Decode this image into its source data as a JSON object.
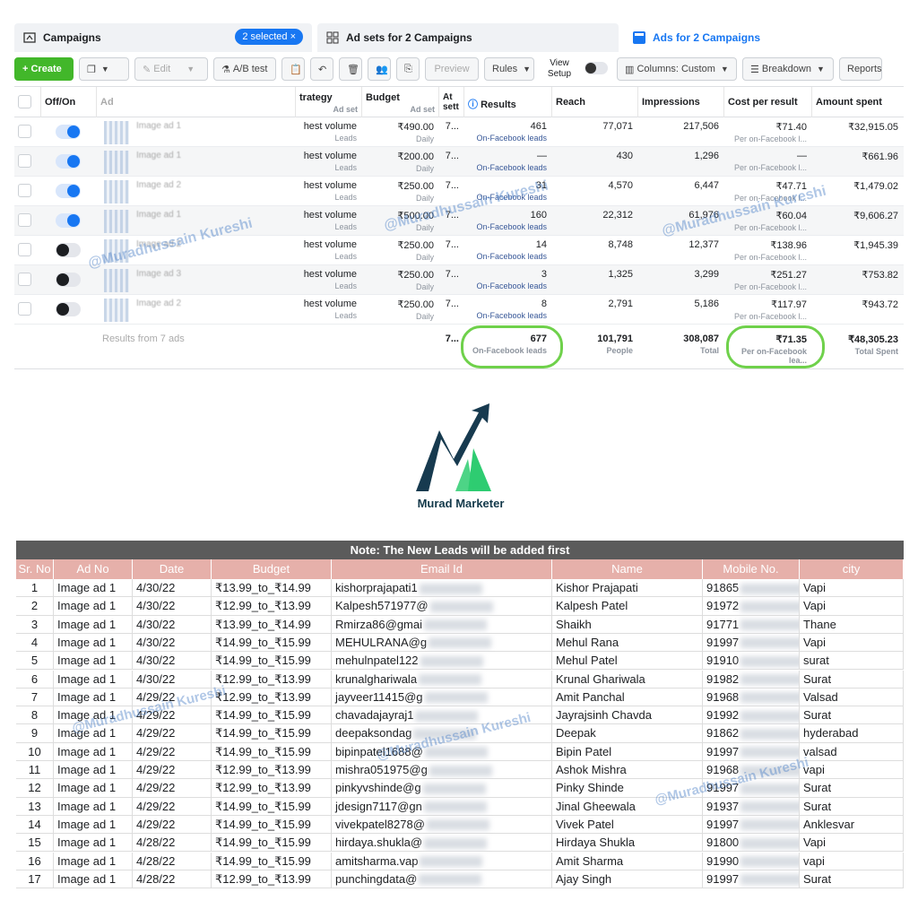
{
  "tabs": {
    "campaigns": "Campaigns",
    "selected": "2 selected",
    "adsets": "Ad sets for 2 Campaigns",
    "ads": "Ads for 2 Campaigns"
  },
  "toolbar": {
    "create": "+ Create",
    "edit": "Edit",
    "abtest": "A/B test",
    "preview": "Preview",
    "rules": "Rules",
    "view_setup": "View Setup",
    "columns": "Columns: Custom",
    "breakdown": "Breakdown",
    "reports": "Reports"
  },
  "columns": {
    "offon": "Off/On",
    "ad": "Ad",
    "strategy": "trategy",
    "budget": "Budget",
    "budget_sub": "Ad set",
    "strategy_sub": "Ad set",
    "attr": "At sett",
    "results": "Results",
    "reach": "Reach",
    "impressions": "Impressions",
    "cpr": "Cost per result",
    "spent": "Amount spent"
  },
  "ads": [
    {
      "name": "Image ad 1",
      "on": true,
      "strategy": "hest volume",
      "strategy_sub": "Leads",
      "budget": "₹490.00",
      "budget_sub": "Daily",
      "attr": "7...",
      "results": "461",
      "results_sub": "On-Facebook leads",
      "reach": "77,071",
      "impressions": "217,506",
      "cpr": "₹71.40",
      "cpr_sub": "Per on-Facebook l...",
      "spent": "₹32,915.05"
    },
    {
      "name": "Image ad 1",
      "on": true,
      "strategy": "hest volume",
      "strategy_sub": "Leads",
      "budget": "₹200.00",
      "budget_sub": "Daily",
      "attr": "7...",
      "results": "—",
      "results_sub": "On-Facebook leads",
      "reach": "430",
      "impressions": "1,296",
      "cpr": "—",
      "cpr_sub": "Per on-Facebook l...",
      "spent": "₹661.96"
    },
    {
      "name": "Image ad 2",
      "on": true,
      "strategy": "hest volume",
      "strategy_sub": "Leads",
      "budget": "₹250.00",
      "budget_sub": "Daily",
      "attr": "7...",
      "results": "31",
      "results_sub": "On-Facebook leads",
      "reach": "4,570",
      "impressions": "6,447",
      "cpr": "₹47.71",
      "cpr_sub": "Per on-Facebook l...",
      "spent": "₹1,479.02"
    },
    {
      "name": "Image ad 1",
      "on": true,
      "strategy": "hest volume",
      "strategy_sub": "Leads",
      "budget": "₹500.00",
      "budget_sub": "Daily",
      "attr": "7...",
      "results": "160",
      "results_sub": "On-Facebook leads",
      "reach": "22,312",
      "impressions": "61,976",
      "cpr": "₹60.04",
      "cpr_sub": "Per on-Facebook l...",
      "spent": "₹9,606.27"
    },
    {
      "name": "Image ad 2",
      "on": false,
      "strategy": "hest volume",
      "strategy_sub": "Leads",
      "budget": "₹250.00",
      "budget_sub": "Daily",
      "attr": "7...",
      "results": "14",
      "results_sub": "On-Facebook leads",
      "reach": "8,748",
      "impressions": "12,377",
      "cpr": "₹138.96",
      "cpr_sub": "Per on-Facebook l...",
      "spent": "₹1,945.39"
    },
    {
      "name": "Image ad 3",
      "on": false,
      "strategy": "hest volume",
      "strategy_sub": "Leads",
      "budget": "₹250.00",
      "budget_sub": "Daily",
      "attr": "7...",
      "results": "3",
      "results_sub": "On-Facebook leads",
      "reach": "1,325",
      "impressions": "3,299",
      "cpr": "₹251.27",
      "cpr_sub": "Per on-Facebook l...",
      "spent": "₹753.82"
    },
    {
      "name": "Image ad 2",
      "on": false,
      "strategy": "hest volume",
      "strategy_sub": "Leads",
      "budget": "₹250.00",
      "budget_sub": "Daily",
      "attr": "7...",
      "results": "8",
      "results_sub": "On-Facebook leads",
      "reach": "2,791",
      "impressions": "5,186",
      "cpr": "₹117.97",
      "cpr_sub": "Per on-Facebook l...",
      "spent": "₹943.72"
    }
  ],
  "totals": {
    "label": "Results from 7 ads",
    "attr": "7...",
    "results": "677",
    "results_sub": "On-Facebook leads",
    "reach": "101,791",
    "reach_sub": "People",
    "impressions": "308,087",
    "impressions_sub": "Total",
    "cpr": "₹71.35",
    "cpr_sub": "Per on-Facebook lea...",
    "spent": "₹48,305.23",
    "spent_sub": "Total Spent"
  },
  "watermark": "@Muradhussain Kureshi",
  "logo": {
    "name": "Murad Marketer",
    "colors": {
      "dark": "#173a4f",
      "green": "#2ecc71"
    }
  },
  "sheet": {
    "note": "Note: The New Leads will be added first",
    "headers": [
      "Sr. No",
      "Ad No",
      "Date",
      "Budget",
      "Email Id",
      "Name",
      "Mobile No.",
      "city"
    ],
    "rows": [
      [
        "1",
        "Image ad 1",
        "4/30/22",
        "₹13.99_to_₹14.99",
        "kishorprajapati1",
        "Kishor Prajapati",
        "91865",
        "Vapi"
      ],
      [
        "2",
        "Image ad 1",
        "4/30/22",
        "₹12.99_to_₹13.99",
        "Kalpesh571977@",
        "Kalpesh Patel",
        "91972",
        "Vapi"
      ],
      [
        "3",
        "Image ad 1",
        "4/30/22",
        "₹13.99_to_₹14.99",
        "Rmirza86@gmai",
        "Shaikh",
        "91771",
        "Thane"
      ],
      [
        "4",
        "Image ad 1",
        "4/30/22",
        "₹14.99_to_₹15.99",
        "MEHULRANA@g",
        "Mehul Rana",
        "91997",
        "Vapi"
      ],
      [
        "5",
        "Image ad 1",
        "4/30/22",
        "₹14.99_to_₹15.99",
        "mehulnpatel122",
        "Mehul Patel",
        "91910",
        "surat"
      ],
      [
        "6",
        "Image ad 1",
        "4/30/22",
        "₹12.99_to_₹13.99",
        "krunalghariwala",
        "Krunal Ghariwala",
        "91982",
        "Surat"
      ],
      [
        "7",
        "Image ad 1",
        "4/29/22",
        "₹12.99_to_₹13.99",
        "jayveer11415@g",
        "Amit Panchal",
        "91968",
        "Valsad"
      ],
      [
        "8",
        "Image ad 1",
        "4/29/22",
        "₹14.99_to_₹15.99",
        "chavadajayraj1",
        "Jayrajsinh Chavda",
        "91992",
        "Surat"
      ],
      [
        "9",
        "Image ad 1",
        "4/29/22",
        "₹14.99_to_₹15.99",
        "deepaksondag",
        "Deepak",
        "91862",
        "hyderabad"
      ],
      [
        "10",
        "Image ad 1",
        "4/29/22",
        "₹14.99_to_₹15.99",
        "bipinpatel1688@",
        "Bipin Patel",
        "91997",
        "valsad"
      ],
      [
        "11",
        "Image ad 1",
        "4/29/22",
        "₹12.99_to_₹13.99",
        "mishra051975@g",
        "Ashok Mishra",
        "91968",
        "vapi"
      ],
      [
        "12",
        "Image ad 1",
        "4/29/22",
        "₹12.99_to_₹13.99",
        "pinkyvshinde@g",
        "Pinky Shinde",
        "91997",
        "Surat"
      ],
      [
        "13",
        "Image ad 1",
        "4/29/22",
        "₹14.99_to_₹15.99",
        "jdesign7117@gn",
        "Jinal Gheewala",
        "91937",
        "Surat"
      ],
      [
        "14",
        "Image ad 1",
        "4/29/22",
        "₹14.99_to_₹15.99",
        "vivekpatel8278@",
        "Vivek Patel",
        "91997",
        "Anklesvar"
      ],
      [
        "15",
        "Image ad 1",
        "4/28/22",
        "₹14.99_to_₹15.99",
        "hirdaya.shukla@",
        "Hirdaya Shukla",
        "91800",
        "Vapi"
      ],
      [
        "16",
        "Image ad 1",
        "4/28/22",
        "₹14.99_to_₹15.99",
        "amitsharma.vap",
        "Amit Sharma",
        "91990",
        "vapi"
      ],
      [
        "17",
        "Image ad 1",
        "4/28/22",
        "₹12.99_to_₹13.99",
        "punchingdata@",
        "Ajay Singh",
        "91997",
        "Surat"
      ]
    ]
  }
}
